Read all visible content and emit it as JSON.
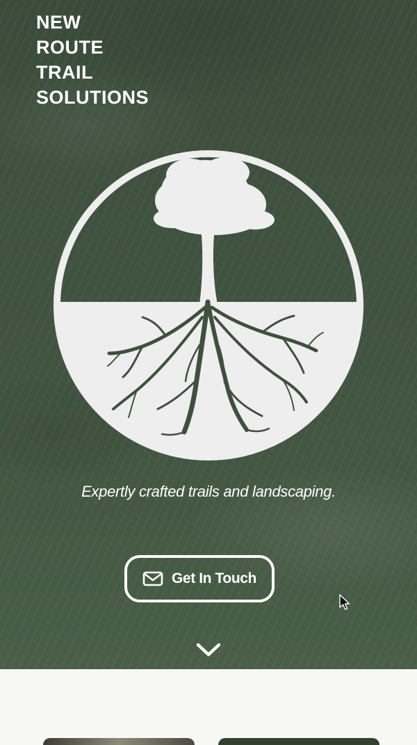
{
  "brand": {
    "lines": [
      "NEW",
      "ROUTE",
      "TRAIL",
      "SOLUTIONS"
    ]
  },
  "hero": {
    "logo_icon": "tree-roots-icon",
    "tagline": "Expertly crafted trails and landscaping.",
    "cta_label": "Get In Touch",
    "cta_icon": "mail-icon",
    "scroll_icon": "chevron-down-icon",
    "colors": {
      "background": "#415341",
      "foreground": "#ffffff",
      "logo": "#eeeeee"
    }
  },
  "below": {
    "background": "#f7f7f6"
  }
}
